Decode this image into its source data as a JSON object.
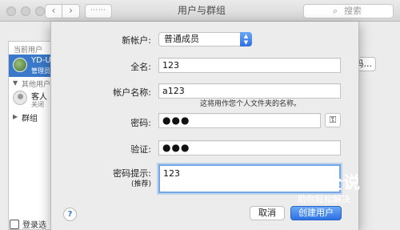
{
  "window": {
    "title": "用户与群组",
    "search_placeholder": "搜索",
    "nav": {
      "back": "‹",
      "forward": "›",
      "grid": "⋯⋯"
    }
  },
  "sidebar": {
    "current_users_header": "当前用户",
    "current_user": {
      "name": "YD-U",
      "role": "管理员"
    },
    "other_users_header": "其他用户",
    "other_user": {
      "name": "客人",
      "status": "关闭"
    },
    "groups_label": "群组",
    "lock_label": "登录选"
  },
  "background": {
    "change_password_label": "码..."
  },
  "sheet": {
    "new_account_label": "新帐户:",
    "new_account_value": "普通成员",
    "full_name_label": "全名:",
    "full_name_value": "123",
    "account_name_label": "帐户名称:",
    "account_name_value": "a123",
    "account_name_hint": "这将用作您个人文件夹的名称。",
    "password_label": "密码:",
    "password_value": "●●●",
    "verify_label": "验证:",
    "verify_value": "●●●",
    "password_hint_label": "密码提示:",
    "password_hint_sublabel": "(推荐)",
    "password_hint_value": "123",
    "help_label": "?",
    "cancel_label": "取消",
    "create_label": "创建用户"
  },
  "watermark": {
    "main": "百科全说",
    "sub": "助你轻松解决"
  },
  "colors": {
    "accent": "#2d72e4",
    "selection": "#3a78c9",
    "sheet_bg": "#ececec"
  }
}
